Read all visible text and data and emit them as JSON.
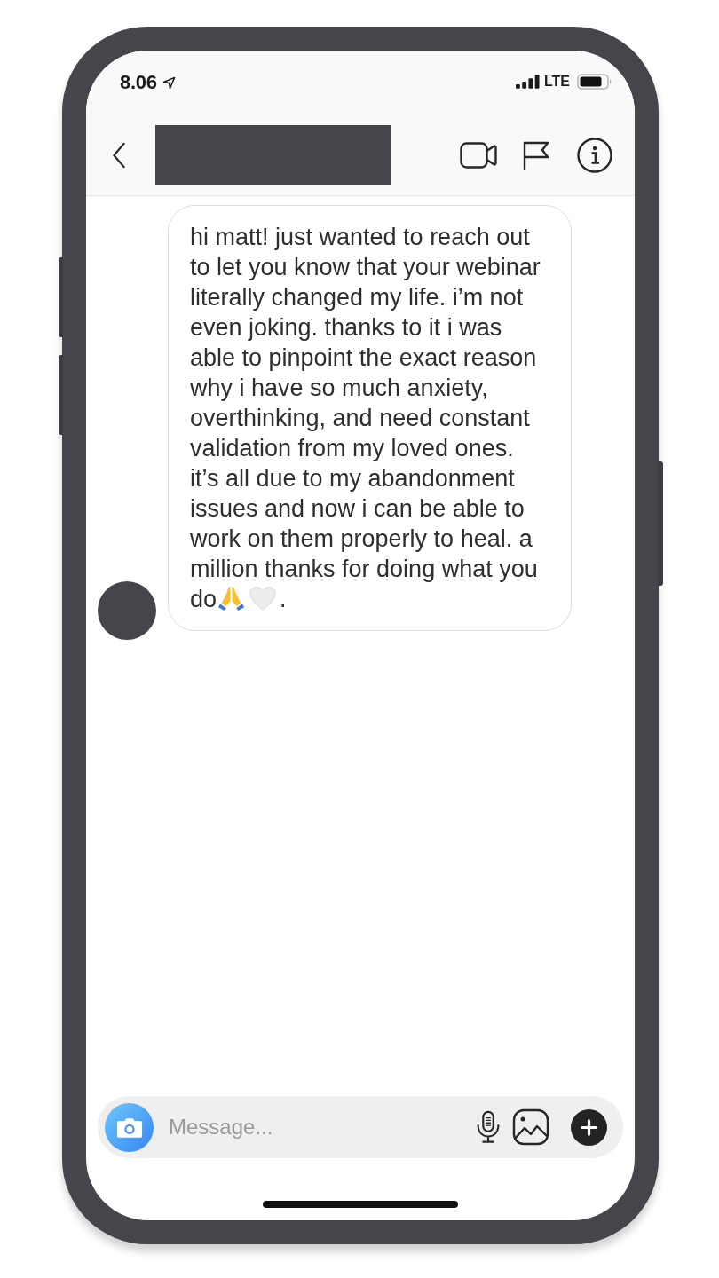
{
  "status_bar": {
    "time": "8.06",
    "network": "LTE"
  },
  "message": {
    "text": "hi matt! just wanted to reach out to let you know that your webinar literally changed my life. i’m not even joking. thanks to it i was able to pinpoint the exact reason why i have so much anxiety, overthinking, and need constant validation from my loved ones. it’s all due to my abandonment issues and now i can be able to work on them properly to heal. a million thanks for doing what you do",
    "emojis": [
      {
        "kind": "praying_hands"
      },
      {
        "kind": "white_heart"
      }
    ],
    "text_after": "."
  },
  "composer": {
    "placeholder": "Message..."
  }
}
